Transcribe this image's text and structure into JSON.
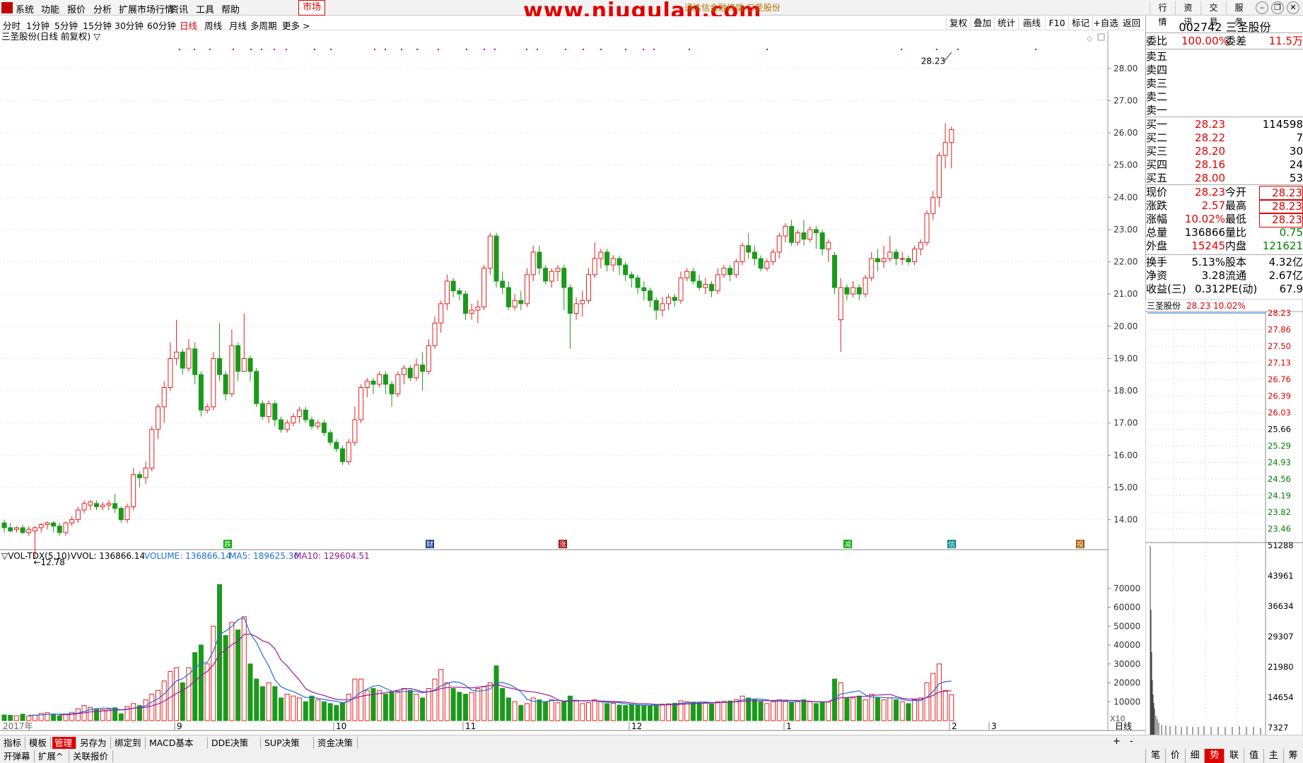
{
  "menubar": {
    "items": [
      "系统",
      "功能",
      "报价",
      "分析",
      "扩展市场行情",
      "资讯",
      "工具",
      "帮助"
    ],
    "market_tab": "市场",
    "watermark": "www.niugulan.com",
    "window_title": "通达信金融终端  三圣股份",
    "right_buttons": [
      "行情",
      "资讯",
      "交易",
      "服务"
    ]
  },
  "periods": {
    "items": [
      "分时",
      "1分钟",
      "5分钟",
      "15分钟",
      "30分钟",
      "60分钟",
      "日线",
      "周线",
      "月线",
      "多周期",
      "更多 >"
    ],
    "active": "日线"
  },
  "tools": [
    "复权",
    "叠加",
    "统计",
    "画线",
    "F10",
    "标记",
    "+自选",
    "返回"
  ],
  "chart": {
    "stock_title": "三圣股份(日线 前复权) ▽",
    "high_label": "28.23",
    "low_label": "←12.78",
    "price_ticks": [
      "28.00",
      "27.00",
      "26.00",
      "25.00",
      "24.00",
      "23.00",
      "22.00",
      "21.00",
      "20.00",
      "19.00",
      "18.00",
      "17.00",
      "16.00",
      "15.00",
      "14.00"
    ],
    "event_markers": [
      {
        "label": "跌",
        "color": "#00aa00"
      },
      {
        "label": "财",
        "color": "#1f3f8f"
      },
      {
        "label": "涨",
        "color": "#aa0000"
      },
      {
        "label": "减",
        "color": "#00aa00"
      },
      {
        "label": "信",
        "color": "#008888"
      },
      {
        "label": "投",
        "color": "#aa5500"
      }
    ],
    "date_labels": [
      "2017年",
      "9",
      "10",
      "11",
      "12",
      "1",
      "2",
      "3"
    ],
    "volume_header": {
      "name": "▽VOL-TDX(5,10)",
      "vvol": "VVOL: 136866.14",
      "volume": "VOLUME: 136866.14",
      "ma5": "MA5: 189625.30",
      "ma10": "MA10: 129604.51"
    },
    "volume_ticks": [
      "70000",
      "60000",
      "50000",
      "40000",
      "30000",
      "20000",
      "10000"
    ],
    "volume_unit": "X10",
    "period_label": "日线",
    "colors": {
      "up": "#e02020",
      "down": "#1a9a1a",
      "ma5": "#1a6fdf",
      "ma10": "#9a1a9a"
    }
  },
  "chart_data": {
    "type": "candlestick",
    "title": "三圣股份(日线 前复权)",
    "ylim": [
      12.5,
      28.5
    ],
    "candles": [
      [
        13.9,
        13.75,
        14.0,
        13.6
      ],
      [
        13.75,
        13.65,
        13.9,
        13.6
      ],
      [
        13.7,
        13.75,
        13.8,
        13.6
      ],
      [
        13.75,
        13.6,
        13.85,
        13.55
      ],
      [
        13.6,
        13.7,
        13.8,
        13.5
      ],
      [
        13.65,
        13.75,
        13.8,
        12.78
      ],
      [
        13.75,
        13.85,
        13.9,
        13.6
      ],
      [
        13.85,
        13.9,
        13.95,
        13.7
      ],
      [
        13.9,
        13.8,
        13.95,
        13.6
      ],
      [
        13.8,
        13.6,
        13.9,
        13.5
      ],
      [
        13.6,
        13.9,
        13.95,
        13.5
      ],
      [
        13.9,
        14.0,
        14.1,
        13.8
      ],
      [
        14.0,
        14.3,
        14.4,
        13.9
      ],
      [
        14.3,
        14.5,
        14.6,
        14.2
      ],
      [
        14.45,
        14.55,
        14.6,
        14.3
      ],
      [
        14.5,
        14.4,
        14.6,
        14.3
      ],
      [
        14.4,
        14.45,
        14.55,
        14.3
      ],
      [
        14.45,
        14.5,
        14.6,
        14.3
      ],
      [
        14.5,
        14.35,
        14.8,
        14.2
      ],
      [
        14.35,
        14.0,
        14.4,
        13.9
      ],
      [
        14.0,
        14.4,
        14.5,
        13.9
      ],
      [
        14.4,
        15.4,
        15.6,
        14.3
      ],
      [
        15.4,
        15.3,
        15.5,
        15.0
      ],
      [
        15.3,
        15.6,
        15.8,
        15.1
      ],
      [
        15.6,
        16.8,
        16.9,
        15.5
      ],
      [
        16.8,
        17.5,
        17.6,
        16.5
      ],
      [
        17.5,
        18.1,
        18.3,
        17.0
      ],
      [
        18.1,
        19.0,
        19.5,
        18.0
      ],
      [
        19.0,
        19.2,
        20.2,
        18.8
      ],
      [
        19.2,
        18.7,
        19.3,
        18.5
      ],
      [
        18.7,
        19.3,
        19.6,
        18.6
      ],
      [
        19.3,
        18.5,
        19.5,
        18.2
      ],
      [
        18.5,
        17.4,
        18.6,
        17.2
      ],
      [
        17.4,
        17.5,
        17.6,
        17.3
      ],
      [
        17.5,
        19.0,
        19.2,
        17.4
      ],
      [
        19.0,
        18.5,
        20.1,
        18.3
      ],
      [
        18.5,
        17.9,
        18.6,
        17.7
      ],
      [
        17.9,
        19.4,
        19.9,
        17.8
      ],
      [
        19.4,
        18.6,
        19.5,
        18.3
      ],
      [
        18.6,
        19.0,
        20.4,
        18.8
      ],
      [
        19.0,
        18.6,
        19.1,
        18.3
      ],
      [
        18.6,
        17.6,
        18.7,
        17.5
      ],
      [
        17.6,
        17.2,
        17.7,
        17.1
      ],
      [
        17.2,
        17.6,
        17.7,
        17.0
      ],
      [
        17.6,
        17.1,
        17.7,
        16.9
      ],
      [
        17.1,
        16.8,
        17.2,
        16.7
      ],
      [
        16.8,
        17.0,
        17.1,
        16.7
      ],
      [
        17.0,
        17.2,
        17.3,
        16.9
      ],
      [
        17.2,
        17.4,
        17.5,
        17.0
      ],
      [
        17.4,
        17.1,
        17.5,
        17.0
      ],
      [
        17.1,
        16.9,
        17.2,
        16.8
      ],
      [
        16.9,
        17.0,
        17.1,
        16.8
      ],
      [
        17.0,
        16.7,
        17.1,
        16.6
      ],
      [
        16.7,
        16.4,
        16.8,
        16.3
      ],
      [
        16.4,
        16.2,
        16.5,
        16.1
      ],
      [
        16.2,
        15.8,
        16.3,
        15.7
      ],
      [
        15.8,
        16.4,
        16.5,
        15.7
      ],
      [
        16.4,
        17.1,
        17.5,
        16.3
      ],
      [
        17.1,
        18.1,
        18.2,
        17.0
      ],
      [
        18.1,
        18.3,
        18.4,
        17.8
      ],
      [
        18.3,
        18.2,
        18.4,
        17.9
      ],
      [
        18.2,
        18.5,
        18.6,
        18.1
      ],
      [
        18.5,
        18.2,
        18.6,
        17.9
      ],
      [
        18.2,
        17.9,
        18.3,
        17.5
      ],
      [
        17.9,
        18.5,
        18.6,
        17.8
      ],
      [
        18.5,
        18.7,
        18.8,
        18.2
      ],
      [
        18.7,
        18.4,
        18.8,
        18.3
      ],
      [
        18.4,
        18.8,
        19.0,
        18.3
      ],
      [
        18.8,
        18.6,
        19.2,
        18.0
      ],
      [
        18.6,
        19.4,
        19.6,
        18.5
      ],
      [
        19.4,
        20.1,
        20.3,
        19.3
      ],
      [
        20.1,
        20.7,
        20.8,
        19.8
      ],
      [
        20.7,
        21.4,
        21.6,
        20.5
      ],
      [
        21.4,
        21.1,
        21.5,
        20.9
      ],
      [
        21.1,
        21.0,
        21.2,
        20.8
      ],
      [
        21.0,
        20.4,
        21.1,
        20.2
      ],
      [
        20.4,
        20.5,
        20.7,
        20.2
      ],
      [
        20.5,
        20.6,
        20.8,
        20.1
      ],
      [
        20.6,
        21.8,
        21.9,
        20.5
      ],
      [
        21.8,
        22.8,
        22.9,
        21.6
      ],
      [
        22.8,
        21.4,
        22.9,
        21.2
      ],
      [
        21.4,
        21.2,
        21.7,
        21.0
      ],
      [
        21.2,
        20.6,
        21.4,
        20.5
      ],
      [
        20.6,
        20.8,
        21.0,
        20.5
      ],
      [
        20.8,
        20.7,
        21.1,
        20.5
      ],
      [
        20.7,
        21.6,
        21.8,
        20.6
      ],
      [
        21.6,
        22.3,
        22.5,
        21.4
      ],
      [
        22.3,
        21.8,
        22.5,
        21.6
      ],
      [
        21.8,
        21.4,
        21.9,
        21.3
      ],
      [
        21.4,
        21.7,
        21.8,
        21.2
      ],
      [
        21.7,
        21.8,
        21.9,
        21.4
      ],
      [
        21.8,
        21.2,
        21.9,
        20.5
      ],
      [
        21.2,
        20.4,
        21.3,
        19.3
      ],
      [
        20.4,
        20.7,
        20.9,
        20.2
      ],
      [
        20.7,
        20.8,
        21.1,
        20.3
      ],
      [
        20.8,
        21.6,
        21.8,
        20.7
      ],
      [
        21.6,
        22.1,
        22.6,
        21.5
      ],
      [
        22.1,
        22.3,
        22.4,
        21.8
      ],
      [
        22.3,
        21.9,
        22.4,
        21.7
      ],
      [
        21.9,
        22.1,
        22.2,
        21.7
      ],
      [
        22.1,
        21.9,
        22.2,
        21.6
      ],
      [
        21.9,
        21.6,
        22.0,
        21.4
      ],
      [
        21.6,
        21.5,
        21.7,
        21.2
      ],
      [
        21.5,
        21.2,
        21.6,
        21.0
      ],
      [
        21.2,
        21.1,
        21.4,
        20.8
      ],
      [
        21.1,
        20.8,
        21.2,
        20.6
      ],
      [
        20.8,
        20.5,
        20.9,
        20.2
      ],
      [
        20.5,
        20.7,
        20.9,
        20.3
      ],
      [
        20.7,
        20.9,
        21.0,
        20.5
      ],
      [
        20.9,
        20.8,
        21.0,
        20.6
      ],
      [
        20.8,
        21.5,
        21.7,
        20.7
      ],
      [
        21.5,
        21.7,
        21.8,
        21.4
      ],
      [
        21.7,
        21.4,
        21.8,
        21.3
      ],
      [
        21.4,
        21.2,
        21.6,
        21.1
      ],
      [
        21.2,
        21.3,
        21.5,
        21.0
      ],
      [
        21.3,
        21.1,
        21.4,
        20.9
      ],
      [
        21.1,
        21.6,
        21.8,
        21.0
      ],
      [
        21.6,
        21.8,
        21.9,
        21.5
      ],
      [
        21.8,
        21.6,
        21.9,
        21.4
      ],
      [
        21.6,
        22.0,
        22.1,
        21.5
      ],
      [
        22.0,
        22.5,
        22.6,
        21.9
      ],
      [
        22.5,
        22.3,
        22.9,
        22.1
      ],
      [
        22.3,
        22.1,
        22.5,
        21.9
      ],
      [
        22.1,
        21.8,
        22.2,
        21.7
      ],
      [
        21.8,
        22.0,
        22.1,
        21.7
      ],
      [
        22.0,
        22.3,
        22.4,
        21.9
      ],
      [
        22.3,
        22.8,
        22.9,
        22.1
      ],
      [
        22.8,
        23.1,
        23.2,
        22.6
      ],
      [
        23.1,
        22.6,
        23.3,
        22.5
      ],
      [
        22.6,
        22.9,
        23.0,
        22.5
      ],
      [
        22.9,
        22.7,
        23.3,
        22.5
      ],
      [
        22.7,
        23.0,
        23.1,
        22.6
      ],
      [
        23.0,
        22.9,
        23.1,
        22.4
      ],
      [
        22.9,
        22.4,
        23.0,
        22.2
      ],
      [
        22.4,
        22.6,
        22.7,
        22.0
      ],
      [
        22.2,
        21.2,
        22.3,
        21.0
      ],
      [
        20.2,
        21.2,
        21.5,
        19.2
      ],
      [
        21.2,
        21.0,
        21.3,
        20.8
      ],
      [
        21.0,
        21.2,
        21.4,
        20.9
      ],
      [
        21.2,
        21.0,
        21.3,
        20.8
      ],
      [
        21.0,
        21.5,
        21.6,
        20.9
      ],
      [
        21.5,
        22.1,
        22.3,
        21.4
      ],
      [
        22.1,
        22.0,
        22.4,
        21.7
      ],
      [
        22.0,
        22.1,
        22.5,
        21.8
      ],
      [
        22.1,
        22.3,
        22.8,
        22.0
      ],
      [
        22.3,
        22.1,
        22.4,
        21.9
      ],
      [
        22.1,
        22.1,
        22.3,
        21.9
      ],
      [
        22.1,
        22.0,
        22.2,
        21.9
      ],
      [
        22.0,
        22.4,
        22.5,
        21.9
      ],
      [
        22.4,
        22.6,
        22.7,
        22.2
      ],
      [
        22.6,
        23.5,
        23.6,
        22.5
      ],
      [
        23.5,
        24.0,
        24.2,
        23.3
      ],
      [
        24.0,
        25.3,
        25.4,
        23.7
      ],
      [
        25.3,
        25.7,
        26.3,
        24.9
      ],
      [
        25.7,
        26.1,
        26.2,
        24.9
      ]
    ],
    "volume": [
      3000,
      2800,
      2600,
      3400,
      2400,
      2900,
      3800,
      4200,
      3500,
      2600,
      3200,
      4400,
      6200,
      8000,
      7000,
      6000,
      5800,
      6000,
      6800,
      3600,
      7500,
      9000,
      8000,
      11000,
      14000,
      16000,
      21000,
      26000,
      28000,
      20000,
      28000,
      36000,
      40000,
      30000,
      50000,
      72000,
      45000,
      52000,
      48000,
      55000,
      30000,
      22000,
      18000,
      20000,
      18000,
      12000,
      14000,
      13000,
      12000,
      10000,
      13000,
      11000,
      10000,
      9000,
      8000,
      9500,
      14000,
      22000,
      22000,
      16000,
      17000,
      16000,
      14000,
      15000,
      15000,
      17000,
      16000,
      14000,
      12000,
      17000,
      22000,
      27000,
      20000,
      17000,
      15000,
      14000,
      15000,
      17000,
      18000,
      20000,
      29000,
      17000,
      12000,
      10000,
      8000,
      9000,
      12000,
      11000,
      10000,
      11000,
      9500,
      10000,
      13000,
      10500,
      9000,
      9500,
      11000,
      10000,
      9000,
      9200,
      8200,
      8000,
      8500,
      8000,
      8200,
      7800,
      8600,
      8700,
      8900,
      9200,
      10500,
      10000,
      9800,
      9400,
      9600,
      8800,
      10000,
      10200,
      10400,
      11000,
      13000,
      12000,
      11000,
      10000,
      9000,
      10000,
      11000,
      10500,
      9500,
      10000,
      11000,
      10000,
      9000,
      9500,
      9800,
      22000,
      20000,
      12000,
      12000,
      13000,
      11000,
      14000,
      12000,
      11000,
      12000,
      11000,
      10000,
      9000,
      11000,
      12000,
      20000,
      25000,
      30000,
      16000,
      13700
    ]
  },
  "quote": {
    "code_name": "002742 三圣股份",
    "weibi_label": "委比",
    "weibi": "100.00%",
    "weicha_label": "委差",
    "weicha": "11.5万",
    "sells": [
      {
        "label": "卖五"
      },
      {
        "label": "卖四"
      },
      {
        "label": "卖三"
      },
      {
        "label": "卖二"
      },
      {
        "label": "卖一"
      }
    ],
    "buys": [
      {
        "label": "买一",
        "price": "28.23",
        "vol": "114598"
      },
      {
        "label": "买二",
        "price": "28.22",
        "vol": "7"
      },
      {
        "label": "买三",
        "price": "28.20",
        "vol": "30"
      },
      {
        "label": "买四",
        "price": "28.16",
        "vol": "24"
      },
      {
        "label": "买五",
        "price": "28.00",
        "vol": "53"
      }
    ],
    "stats": [
      {
        "l1": "现价",
        "v1": "28.23",
        "c1": "#e00000",
        "l2": "今开",
        "v2": "28.23",
        "c2": "#e00000"
      },
      {
        "l1": "涨跌",
        "v1": "2.57",
        "c1": "#e00000",
        "l2": "最高",
        "v2": "28.23",
        "c2": "#e00000"
      },
      {
        "l1": "涨幅",
        "v1": "10.02%",
        "c1": "#e00000",
        "l2": "最低",
        "v2": "28.23",
        "c2": "#e00000"
      },
      {
        "l1": "总量",
        "v1": "136866",
        "c1": "#000",
        "l2": "量比",
        "v2": "0.75",
        "c2": "#008000"
      },
      {
        "l1": "外盘",
        "v1": "15245",
        "c1": "#e00000",
        "l2": "内盘",
        "v2": "121621",
        "c2": "#008000"
      }
    ],
    "stats2": [
      {
        "l1": "换手",
        "v1": "5.13%",
        "l2": "股本",
        "v2": "4.32亿"
      },
      {
        "l1": "净资",
        "v1": "3.28",
        "l2": "流通",
        "v2": "2.67亿"
      },
      {
        "l1": "收益(三)",
        "v1": "0.312",
        "l2": "PE(动)",
        "v2": "67.9"
      }
    ]
  },
  "minichart": {
    "header_name": "三圣股份",
    "header_price": "28.23",
    "header_pct": "10.02%",
    "price_ticks": [
      "28.23",
      "27.86",
      "27.50",
      "27.13",
      "26.76",
      "26.39",
      "26.03",
      "25.66",
      "25.29",
      "24.93",
      "24.56",
      "24.19",
      "23.82",
      "23.46"
    ],
    "vol_ticks": [
      "51288",
      "43961",
      "36634",
      "29307",
      "21980",
      "14654",
      "7327"
    ]
  },
  "bottom_tabs": [
    "指标",
    "模板",
    "管理",
    "另存为",
    "绑定到",
    "MACD基本",
    "DDE决策",
    "SUP决策",
    "资金决策"
  ],
  "bottom_active": "管理",
  "bottom_row2": [
    "开弹幕",
    "扩展^",
    "关联报价"
  ],
  "right_bottom_tabs": [
    "笔",
    "价",
    "细",
    "势",
    "联",
    "值",
    "主",
    "筹"
  ],
  "right_bottom_active": "势"
}
